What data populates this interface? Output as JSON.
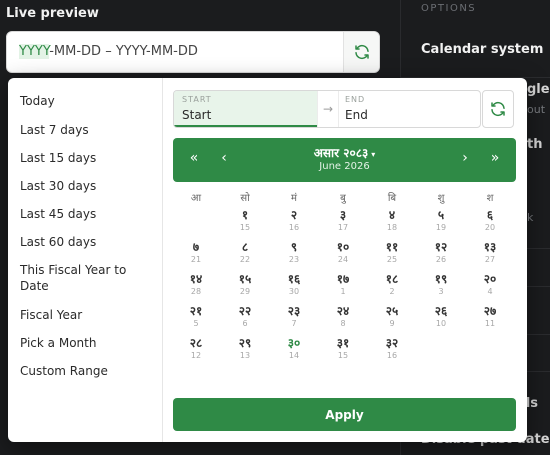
{
  "background": {
    "live_preview_label": "Live preview",
    "input": {
      "highlight": "YYYY",
      "rest": "-MM-DD – YYYY-MM-DD"
    },
    "options_label": "OPTIONS",
    "calendar_system_label": "Calendar system",
    "fragments": [
      "gle",
      "out",
      "th",
      "k",
      "ds",
      "Disable past dates"
    ]
  },
  "presets": [
    "Today",
    "Last 7 days",
    "Last 15 days",
    "Last 30 days",
    "Last 45 days",
    "Last 60 days",
    "This Fiscal Year to Date",
    "Fiscal Year",
    "Pick a Month",
    "Custom Range"
  ],
  "range": {
    "start_label": "START",
    "start_value": "Start",
    "end_label": "END",
    "end_value": "End",
    "arrow": "→"
  },
  "calendar": {
    "nav_prev_year": "«",
    "nav_prev": "‹",
    "nav_next": "›",
    "nav_next_year": "»",
    "month_title": "असार २०८३",
    "caret": "▾",
    "month_subtitle": "June 2026",
    "weekdays": [
      "आ",
      "सो",
      "मं",
      "बु",
      "बि",
      "शु",
      "श"
    ],
    "weeks": [
      [
        null,
        {
          "n": "१",
          "g": "15"
        },
        {
          "n": "२",
          "g": "16"
        },
        {
          "n": "३",
          "g": "17"
        },
        {
          "n": "४",
          "g": "18"
        },
        {
          "n": "५",
          "g": "19"
        },
        {
          "n": "६",
          "g": "20"
        }
      ],
      [
        {
          "n": "७",
          "g": "21"
        },
        {
          "n": "८",
          "g": "22"
        },
        {
          "n": "९",
          "g": "23"
        },
        {
          "n": "१०",
          "g": "24"
        },
        {
          "n": "११",
          "g": "25"
        },
        {
          "n": "१२",
          "g": "26"
        },
        {
          "n": "१३",
          "g": "27"
        }
      ],
      [
        {
          "n": "१४",
          "g": "28"
        },
        {
          "n": "१५",
          "g": "29"
        },
        {
          "n": "१६",
          "g": "30"
        },
        {
          "n": "१७",
          "g": "1"
        },
        {
          "n": "१८",
          "g": "2"
        },
        {
          "n": "१९",
          "g": "3"
        },
        {
          "n": "२०",
          "g": "4"
        }
      ],
      [
        {
          "n": "२१",
          "g": "5"
        },
        {
          "n": "२२",
          "g": "6"
        },
        {
          "n": "२३",
          "g": "7"
        },
        {
          "n": "२४",
          "g": "8"
        },
        {
          "n": "२५",
          "g": "9"
        },
        {
          "n": "२६",
          "g": "10"
        },
        {
          "n": "२७",
          "g": "11"
        }
      ],
      [
        {
          "n": "२८",
          "g": "12"
        },
        {
          "n": "२९",
          "g": "13"
        },
        {
          "n": "३०",
          "g": "14",
          "today": true
        },
        {
          "n": "३१",
          "g": "15"
        },
        {
          "n": "३२",
          "g": "16"
        },
        null,
        null
      ]
    ]
  },
  "apply_label": "Apply",
  "colors": {
    "accent": "#2f8a46",
    "accent_light": "#e8f4ea",
    "backdrop": "#1b1c1e"
  }
}
